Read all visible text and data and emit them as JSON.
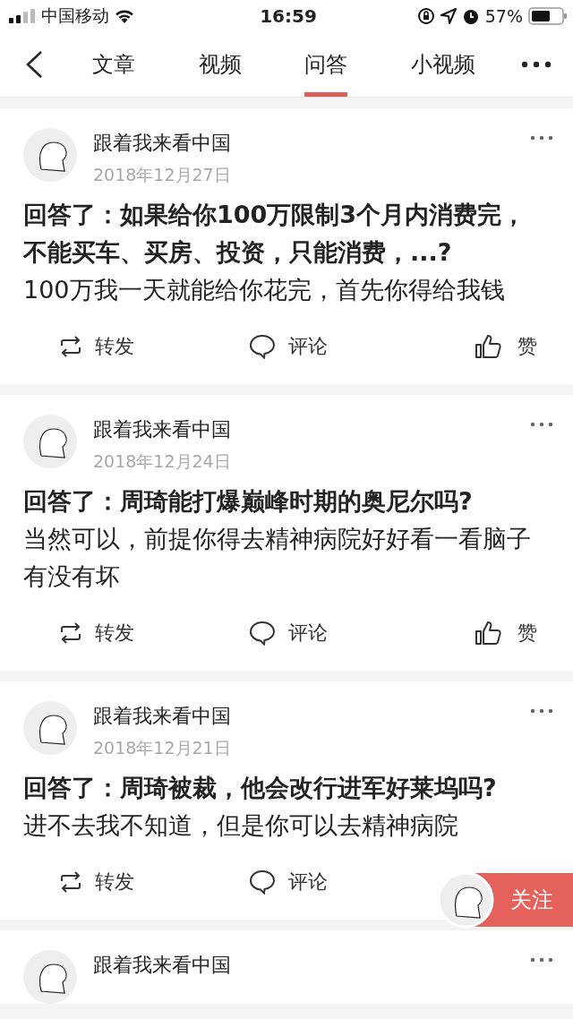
{
  "status_bar": {
    "carrier": "中国移动",
    "time": "16:59",
    "battery": "57%"
  },
  "tabs": [
    {
      "label": "文章",
      "selected": false
    },
    {
      "label": "视频",
      "selected": false
    },
    {
      "label": "问答",
      "selected": true
    },
    {
      "label": "小视频",
      "selected": false
    }
  ],
  "posts": [
    {
      "author": "跟着我来看中国",
      "date": "2018年12月27日",
      "title": "回答了：如果给你100万限制3个月内消费完，不能买车、买房、投资，只能消费，...?",
      "body": "100万我一天就能给你花完，首先你得给我钱",
      "actions": [
        {
          "kind": "repost",
          "label": "转发"
        },
        {
          "kind": "comment",
          "label": "评论"
        },
        {
          "kind": "like",
          "label": "赞"
        }
      ]
    },
    {
      "author": "跟着我来看中国",
      "date": "2018年12月24日",
      "title": "回答了：周琦能打爆巅峰时期的奥尼尔吗?",
      "body": "当然可以，前提你得去精神病院好好看一看脑子有没有坏",
      "actions": [
        {
          "kind": "repost",
          "label": "转发"
        },
        {
          "kind": "comment",
          "label": "评论"
        },
        {
          "kind": "like",
          "label": "赞"
        }
      ]
    },
    {
      "author": "跟着我来看中国",
      "date": "2018年12月21日",
      "title": "回答了：周琦被裁，他会改行进军好莱坞吗?",
      "body": "进不去我不知道，但是你可以去精神病院",
      "actions": [
        {
          "kind": "repost",
          "label": "转发"
        },
        {
          "kind": "comment",
          "label": "评论"
        }
      ]
    },
    {
      "author": "跟着我来看中国"
    }
  ],
  "follow_button": {
    "label": "关注"
  }
}
